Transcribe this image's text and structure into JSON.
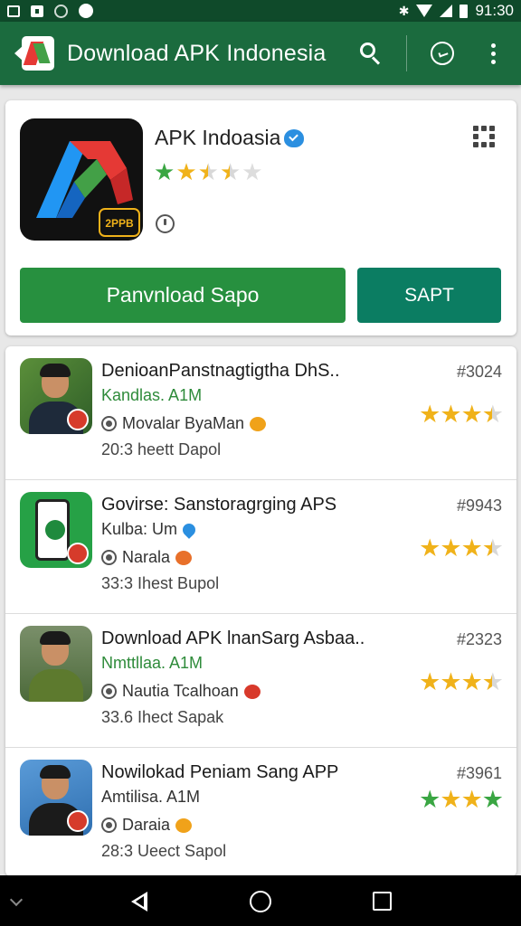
{
  "status_bar": {
    "time": "91:30"
  },
  "app_bar": {
    "title": "Download APK Indonesia"
  },
  "hero": {
    "app_name": "APK Indoasia",
    "rating_stars": 2.5,
    "download_label": "Panvnload Sapo",
    "save_label": "SAPT",
    "logo_text": "2PPB"
  },
  "list": [
    {
      "title": "DenioanPanstnagtigtha DhS..",
      "rank": "#3024",
      "subtitle": "Kandlas. A1M",
      "developer": "Movalar ByaMan",
      "size": "20:3 heett Dapol",
      "thumb_kind": "person-green-bg",
      "stars": 3.5
    },
    {
      "title": "Govirse: Sanstoragrging APS",
      "rank": "#9943",
      "subtitle": "Kulba: Um",
      "developer": "Narala",
      "size": "33:3 Ihest Bupol",
      "thumb_kind": "phone",
      "stars": 3.5
    },
    {
      "title": "Download APK lnanSarg Asbaa..",
      "rank": "#2323",
      "subtitle": "Nmttllaa. A1M",
      "developer": "Nautia Tcalhoan",
      "size": "33.6 Ihect Sapak",
      "thumb_kind": "person-outdoor",
      "stars": 3.5
    },
    {
      "title": "Nowilokad Peniam Sang APP",
      "rank": "#3961",
      "subtitle": "Amtilisa. A1M",
      "developer": "Daraia",
      "size": "28:3 Ueect Sapol",
      "thumb_kind": "person-blue-bg",
      "stars": 4
    }
  ],
  "colors": {
    "app_bar": "#1b6b3e",
    "download_button": "#27903f",
    "save_button": "#0b7d62",
    "star_gold": "#f0b21a",
    "star_green": "#3aa643"
  },
  "icons": [
    "search-icon",
    "chat-icon",
    "more-vert-icon",
    "grid-icon",
    "info-icon",
    "verified-icon",
    "back-icon",
    "home-icon",
    "recents-icon"
  ]
}
